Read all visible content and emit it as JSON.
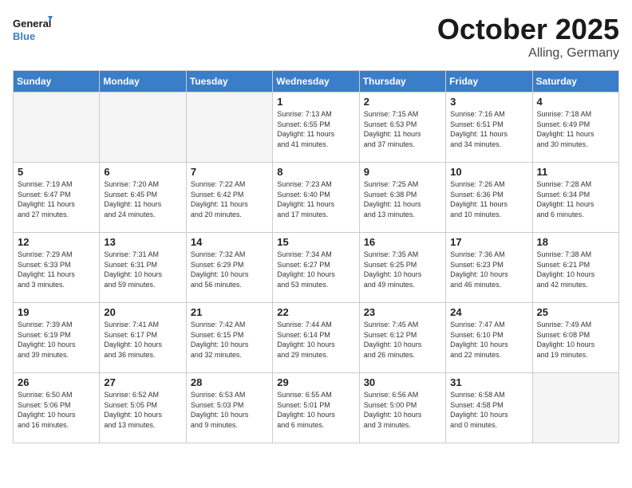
{
  "header": {
    "logo_line1": "General",
    "logo_line2": "Blue",
    "month": "October 2025",
    "location": "Alling, Germany"
  },
  "weekdays": [
    "Sunday",
    "Monday",
    "Tuesday",
    "Wednesday",
    "Thursday",
    "Friday",
    "Saturday"
  ],
  "weeks": [
    [
      {
        "day": "",
        "info": ""
      },
      {
        "day": "",
        "info": ""
      },
      {
        "day": "",
        "info": ""
      },
      {
        "day": "1",
        "info": "Sunrise: 7:13 AM\nSunset: 6:55 PM\nDaylight: 11 hours\nand 41 minutes."
      },
      {
        "day": "2",
        "info": "Sunrise: 7:15 AM\nSunset: 6:53 PM\nDaylight: 11 hours\nand 37 minutes."
      },
      {
        "day": "3",
        "info": "Sunrise: 7:16 AM\nSunset: 6:51 PM\nDaylight: 11 hours\nand 34 minutes."
      },
      {
        "day": "4",
        "info": "Sunrise: 7:18 AM\nSunset: 6:49 PM\nDaylight: 11 hours\nand 30 minutes."
      }
    ],
    [
      {
        "day": "5",
        "info": "Sunrise: 7:19 AM\nSunset: 6:47 PM\nDaylight: 11 hours\nand 27 minutes."
      },
      {
        "day": "6",
        "info": "Sunrise: 7:20 AM\nSunset: 6:45 PM\nDaylight: 11 hours\nand 24 minutes."
      },
      {
        "day": "7",
        "info": "Sunrise: 7:22 AM\nSunset: 6:42 PM\nDaylight: 11 hours\nand 20 minutes."
      },
      {
        "day": "8",
        "info": "Sunrise: 7:23 AM\nSunset: 6:40 PM\nDaylight: 11 hours\nand 17 minutes."
      },
      {
        "day": "9",
        "info": "Sunrise: 7:25 AM\nSunset: 6:38 PM\nDaylight: 11 hours\nand 13 minutes."
      },
      {
        "day": "10",
        "info": "Sunrise: 7:26 AM\nSunset: 6:36 PM\nDaylight: 11 hours\nand 10 minutes."
      },
      {
        "day": "11",
        "info": "Sunrise: 7:28 AM\nSunset: 6:34 PM\nDaylight: 11 hours\nand 6 minutes."
      }
    ],
    [
      {
        "day": "12",
        "info": "Sunrise: 7:29 AM\nSunset: 6:33 PM\nDaylight: 11 hours\nand 3 minutes."
      },
      {
        "day": "13",
        "info": "Sunrise: 7:31 AM\nSunset: 6:31 PM\nDaylight: 10 hours\nand 59 minutes."
      },
      {
        "day": "14",
        "info": "Sunrise: 7:32 AM\nSunset: 6:29 PM\nDaylight: 10 hours\nand 56 minutes."
      },
      {
        "day": "15",
        "info": "Sunrise: 7:34 AM\nSunset: 6:27 PM\nDaylight: 10 hours\nand 53 minutes."
      },
      {
        "day": "16",
        "info": "Sunrise: 7:35 AM\nSunset: 6:25 PM\nDaylight: 10 hours\nand 49 minutes."
      },
      {
        "day": "17",
        "info": "Sunrise: 7:36 AM\nSunset: 6:23 PM\nDaylight: 10 hours\nand 46 minutes."
      },
      {
        "day": "18",
        "info": "Sunrise: 7:38 AM\nSunset: 6:21 PM\nDaylight: 10 hours\nand 42 minutes."
      }
    ],
    [
      {
        "day": "19",
        "info": "Sunrise: 7:39 AM\nSunset: 6:19 PM\nDaylight: 10 hours\nand 39 minutes."
      },
      {
        "day": "20",
        "info": "Sunrise: 7:41 AM\nSunset: 6:17 PM\nDaylight: 10 hours\nand 36 minutes."
      },
      {
        "day": "21",
        "info": "Sunrise: 7:42 AM\nSunset: 6:15 PM\nDaylight: 10 hours\nand 32 minutes."
      },
      {
        "day": "22",
        "info": "Sunrise: 7:44 AM\nSunset: 6:14 PM\nDaylight: 10 hours\nand 29 minutes."
      },
      {
        "day": "23",
        "info": "Sunrise: 7:45 AM\nSunset: 6:12 PM\nDaylight: 10 hours\nand 26 minutes."
      },
      {
        "day": "24",
        "info": "Sunrise: 7:47 AM\nSunset: 6:10 PM\nDaylight: 10 hours\nand 22 minutes."
      },
      {
        "day": "25",
        "info": "Sunrise: 7:49 AM\nSunset: 6:08 PM\nDaylight: 10 hours\nand 19 minutes."
      }
    ],
    [
      {
        "day": "26",
        "info": "Sunrise: 6:50 AM\nSunset: 5:06 PM\nDaylight: 10 hours\nand 16 minutes."
      },
      {
        "day": "27",
        "info": "Sunrise: 6:52 AM\nSunset: 5:05 PM\nDaylight: 10 hours\nand 13 minutes."
      },
      {
        "day": "28",
        "info": "Sunrise: 6:53 AM\nSunset: 5:03 PM\nDaylight: 10 hours\nand 9 minutes."
      },
      {
        "day": "29",
        "info": "Sunrise: 6:55 AM\nSunset: 5:01 PM\nDaylight: 10 hours\nand 6 minutes."
      },
      {
        "day": "30",
        "info": "Sunrise: 6:56 AM\nSunset: 5:00 PM\nDaylight: 10 hours\nand 3 minutes."
      },
      {
        "day": "31",
        "info": "Sunrise: 6:58 AM\nSunset: 4:58 PM\nDaylight: 10 hours\nand 0 minutes."
      },
      {
        "day": "",
        "info": ""
      }
    ]
  ]
}
